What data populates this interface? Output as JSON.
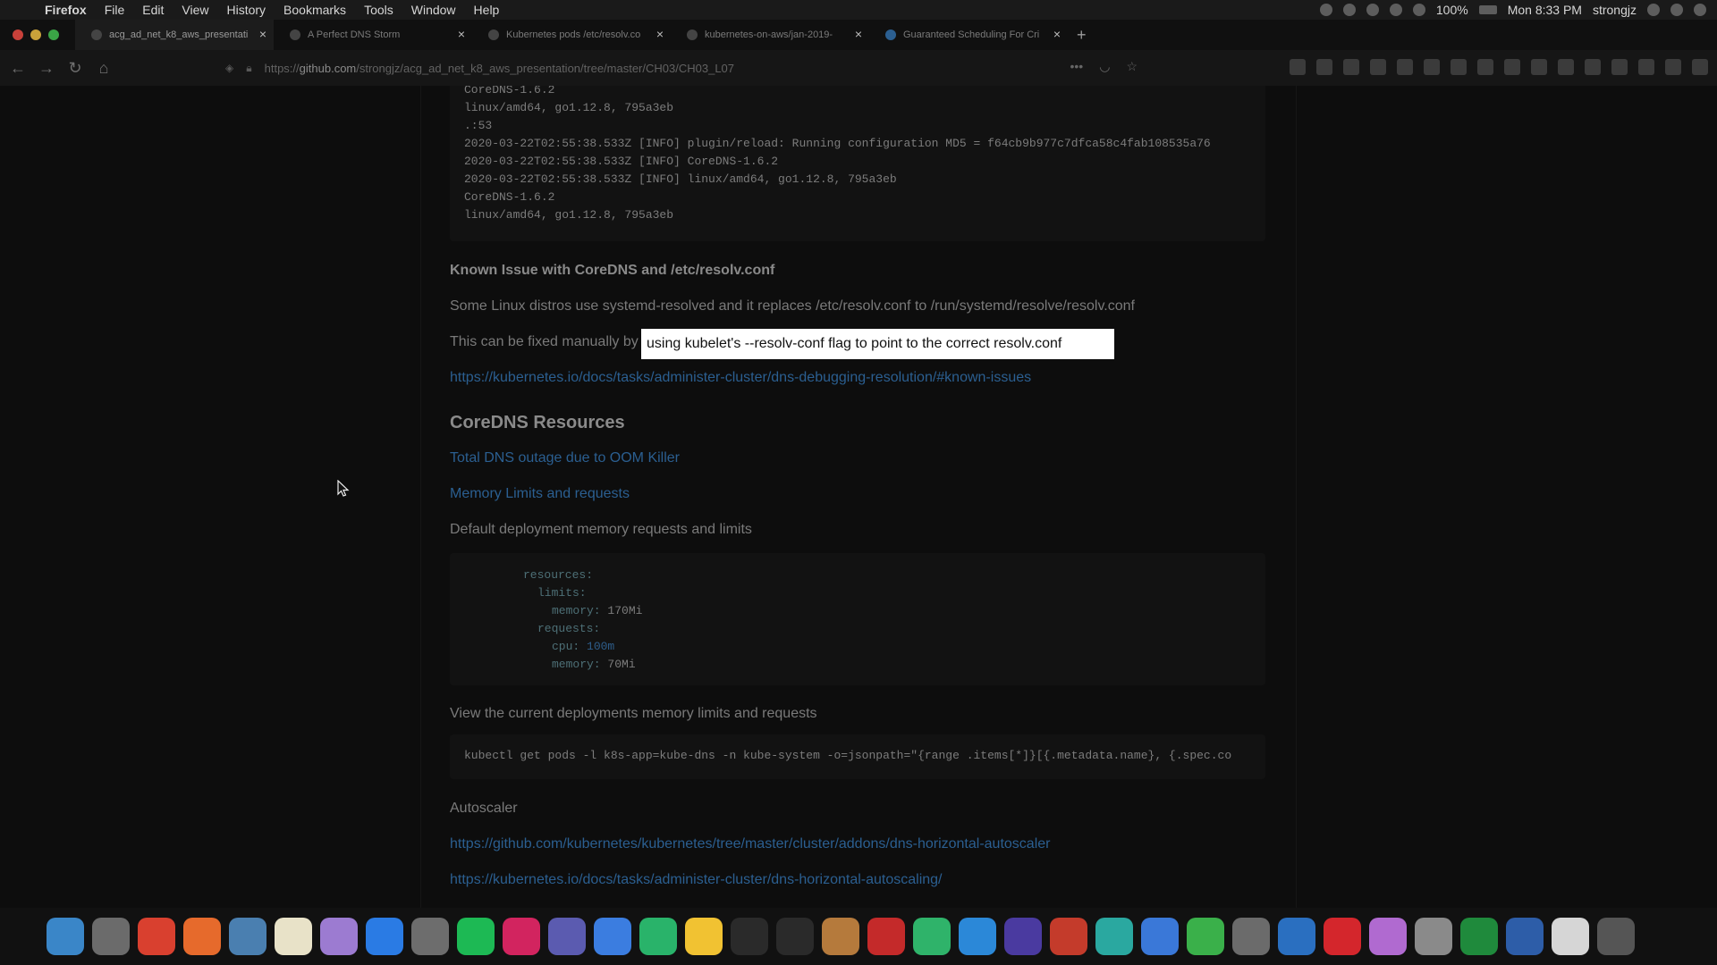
{
  "menubar": {
    "app": "Firefox",
    "items": [
      "File",
      "Edit",
      "View",
      "History",
      "Bookmarks",
      "Tools",
      "Window",
      "Help"
    ],
    "battery": "100%",
    "clock": "Mon 8:33 PM",
    "user": "strongjz"
  },
  "tabs": [
    {
      "title": "acg_ad_net_k8_aws_presentati",
      "active": true
    },
    {
      "title": "A Perfect DNS Storm",
      "active": false
    },
    {
      "title": "Kubernetes pods /etc/resolv.co",
      "active": false
    },
    {
      "title": "kubernetes-on-aws/jan-2019-",
      "active": false
    },
    {
      "title": "Guaranteed Scheduling For Cri",
      "active": false
    }
  ],
  "url": {
    "scheme": "https://",
    "host": "github.com",
    "path": "/strongjz/acg_ad_net_k8_aws_presentation/tree/master/CH03/CH03_L07"
  },
  "log_lines": [
    "CoreDNS-1.6.2",
    "linux/amd64, go1.12.8, 795a3eb",
    ".:53",
    "2020-03-22T02:55:38.533Z [INFO] plugin/reload: Running configuration MD5 = f64cb9b977c7dfca58c4fab108535a76",
    "2020-03-22T02:55:38.533Z [INFO] CoreDNS-1.6.2",
    "2020-03-22T02:55:38.533Z [INFO] linux/amd64, go1.12.8, 795a3eb",
    "CoreDNS-1.6.2",
    "linux/amd64, go1.12.8, 795a3eb"
  ],
  "known_issue": {
    "heading": "Known Issue with CoreDNS and /etc/resolv.conf",
    "para1": "Some Linux distros use systemd-resolved and it replaces /etc/resolv.conf to /run/systemd/resolve/resolv.conf",
    "para2": "This can be fixed manually by",
    "link": "https://kubernetes.io/docs/tasks/administer-cluster/dns-debugging-resolution/#known-issues"
  },
  "caption": "using kubelet's --resolv-conf flag to point to the correct resolv.conf",
  "resources": {
    "heading": "CoreDNS Resources",
    "link1": "Total DNS outage due to OOM Killer",
    "link2": "Memory Limits and requests",
    "default_text": "Default deployment memory requests and limits",
    "yaml": {
      "resources": "resources:",
      "limits": "limits:",
      "mem_key": "memory:",
      "mem_limit": "170Mi",
      "requests": "requests:",
      "cpu_key": "cpu:",
      "cpu_val": "100m",
      "mem_req": "70Mi"
    },
    "view_text": "View the current deployments memory limits and requests",
    "cmd": "kubectl get pods -l k8s-app=kube-dns -n kube-system -o=jsonpath=\"{range .items[*]}[{.metadata.name}, {.spec.co",
    "autoscaler": "Autoscaler",
    "link3": "https://github.com/kubernetes/kubernetes/tree/master/cluster/addons/dns-horizontal-autoscaler",
    "link4": "https://kubernetes.io/docs/tasks/administer-cluster/dns-horizontal-autoscaling/"
  },
  "dock_colors": [
    "#3a86c8",
    "#6b6b6b",
    "#d9402f",
    "#e66a2c",
    "#4a7fb0",
    "#e8e2c8",
    "#9c7bd1",
    "#2a7be4",
    "#6d6d6d",
    "#1db954",
    "#d2245f",
    "#5b5bb0",
    "#3b7de0",
    "#29b36a",
    "#f1c232",
    "#2a2a2a",
    "#2a2a2a",
    "#b57a3c",
    "#c42a2a",
    "#2fb36a",
    "#2b88d8",
    "#4a3aa0",
    "#c43b2b",
    "#2aa8a0",
    "#3a78d8",
    "#3ab04a",
    "#6b6b6b",
    "#2a6fc0",
    "#d4262c",
    "#b06ad0",
    "#8a8a8a",
    "#1f8a3c",
    "#2d5da8",
    "#d6d6d6",
    "#555555"
  ]
}
